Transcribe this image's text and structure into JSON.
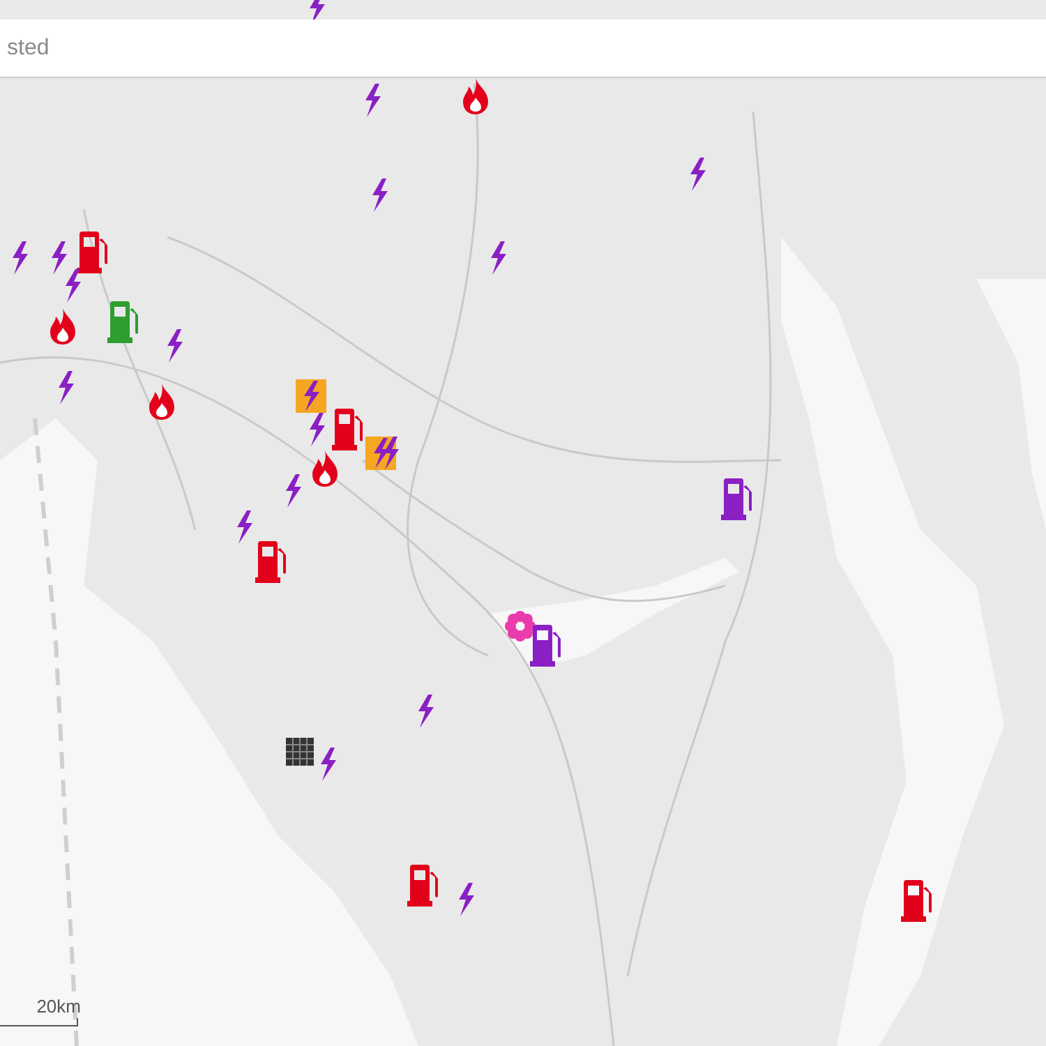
{
  "search": {
    "placeholder": "sted"
  },
  "markers": [
    {
      "kind": "bolt",
      "color": "#8a1fc4"
    },
    {
      "kind": "bolt",
      "color": "#8a1fc4"
    },
    {
      "kind": "fire",
      "color": "#e3001b"
    },
    {
      "kind": "bolt",
      "color": "#8a1fc4"
    },
    {
      "kind": "bolt",
      "color": "#8a1fc4"
    },
    {
      "kind": "fuel",
      "color": "#e3001b"
    },
    {
      "kind": "bolt",
      "color": "#8a1fc4"
    },
    {
      "kind": "bolt",
      "color": "#8a1fc4"
    },
    {
      "kind": "bolt",
      "color": "#8a1fc4"
    },
    {
      "kind": "fire",
      "color": "#e3001b"
    },
    {
      "kind": "fuel",
      "color": "#2e9e2e"
    },
    {
      "kind": "bolt",
      "color": "#8a1fc4"
    },
    {
      "kind": "bolt",
      "color": "#8a1fc4"
    },
    {
      "kind": "fire",
      "color": "#e3001b"
    },
    {
      "kind": "bolt",
      "color": "#8a1fc4"
    },
    {
      "kind": "box-bolt",
      "color": "#f5a623"
    },
    {
      "kind": "fuel",
      "color": "#e3001b"
    },
    {
      "kind": "fire",
      "color": "#e3001b"
    },
    {
      "kind": "box-bolt",
      "color": "#f5a623"
    },
    {
      "kind": "bolt",
      "color": "#8a1fc4"
    },
    {
      "kind": "bolt",
      "color": "#8a1fc4"
    },
    {
      "kind": "bolt",
      "color": "#8a1fc4"
    },
    {
      "kind": "bolt",
      "color": "#8a1fc4"
    },
    {
      "kind": "fuel",
      "color": "#e3001b"
    },
    {
      "kind": "fuel",
      "color": "#8a1fc4"
    },
    {
      "kind": "flower",
      "color": "#e93cac"
    },
    {
      "kind": "fuel",
      "color": "#8a1fc4"
    },
    {
      "kind": "bolt",
      "color": "#8a1fc4"
    },
    {
      "kind": "grid",
      "color": "#333333"
    },
    {
      "kind": "bolt",
      "color": "#8a1fc4"
    },
    {
      "kind": "fuel",
      "color": "#e3001b"
    },
    {
      "kind": "bolt",
      "color": "#8a1fc4"
    },
    {
      "kind": "fuel",
      "color": "#e3001b"
    }
  ],
  "scale_bar": {
    "label": "20km"
  }
}
